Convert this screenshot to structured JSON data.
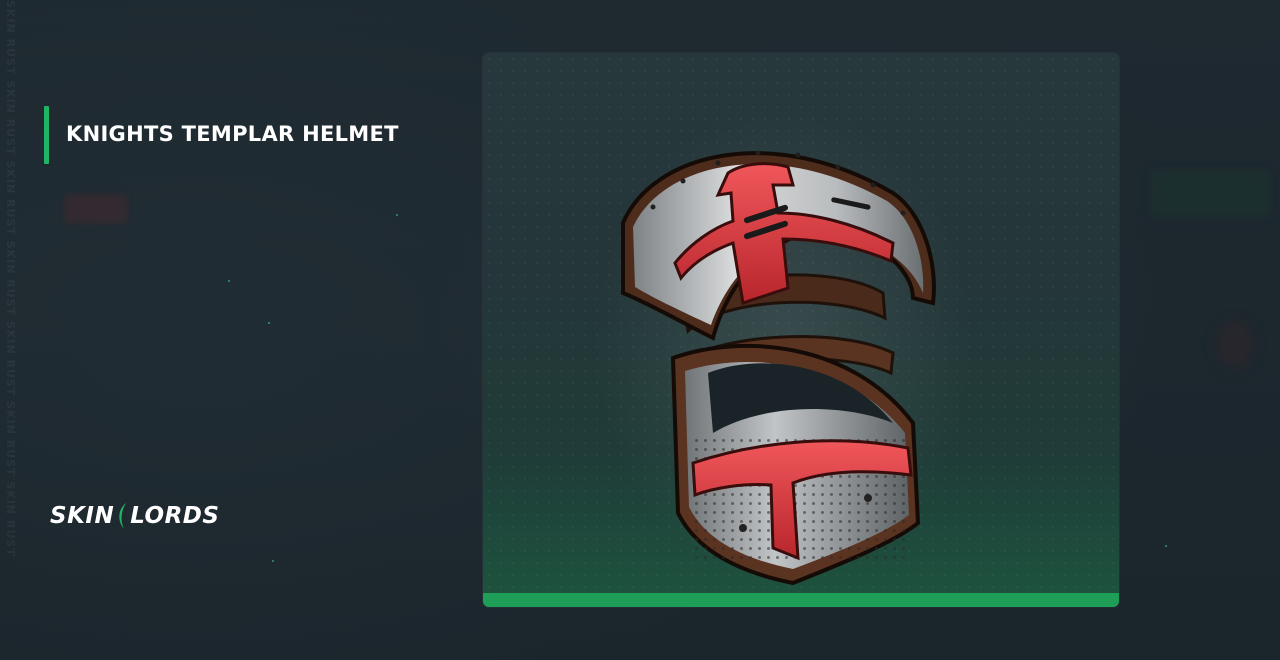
{
  "item": {
    "title": "KNIGHTS TEMPLAR HELMET"
  },
  "brand": {
    "left_text": "SKIN",
    "right_text": "LORDS"
  },
  "watermark": {
    "text": "SKIN RUST SKIN RUST SKIN RUST SKIN RUST SKIN RUST SKIN RUST SKIN RUST"
  },
  "colors": {
    "accent": "#20b564",
    "background": "#1c262d",
    "helmet_red": "#d63a3f",
    "helmet_steel": "#c9cbcc",
    "helmet_leather": "#5a3321"
  }
}
